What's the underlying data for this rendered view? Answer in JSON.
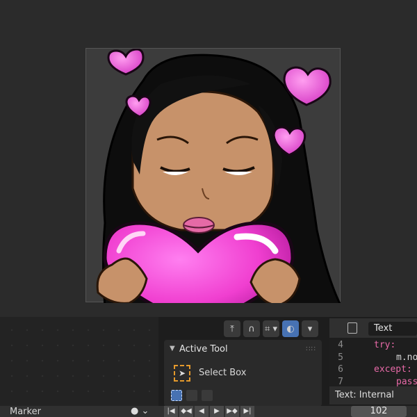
{
  "gizmo_bar": {
    "icons": [
      "transform-pivot-icon",
      "snap-icon",
      "grid-snap-icon",
      "overlay-icon"
    ]
  },
  "active_tool": {
    "title": "Active Tool",
    "tool_label": "Select Box"
  },
  "text_editor": {
    "datablock": "Text",
    "lines": [
      {
        "num": "4",
        "text": "try:"
      },
      {
        "num": "5",
        "text": "m.no"
      },
      {
        "num": "6",
        "text": "except:"
      },
      {
        "num": "7",
        "text": "pass"
      }
    ],
    "footer": "Text: Internal"
  },
  "timeline": {
    "marker_label": "Marker",
    "current_frame": "102"
  },
  "colors": {
    "accent": "#4772b3",
    "tool_highlight": "#e59a2c",
    "keyword": "#e86aa8"
  }
}
